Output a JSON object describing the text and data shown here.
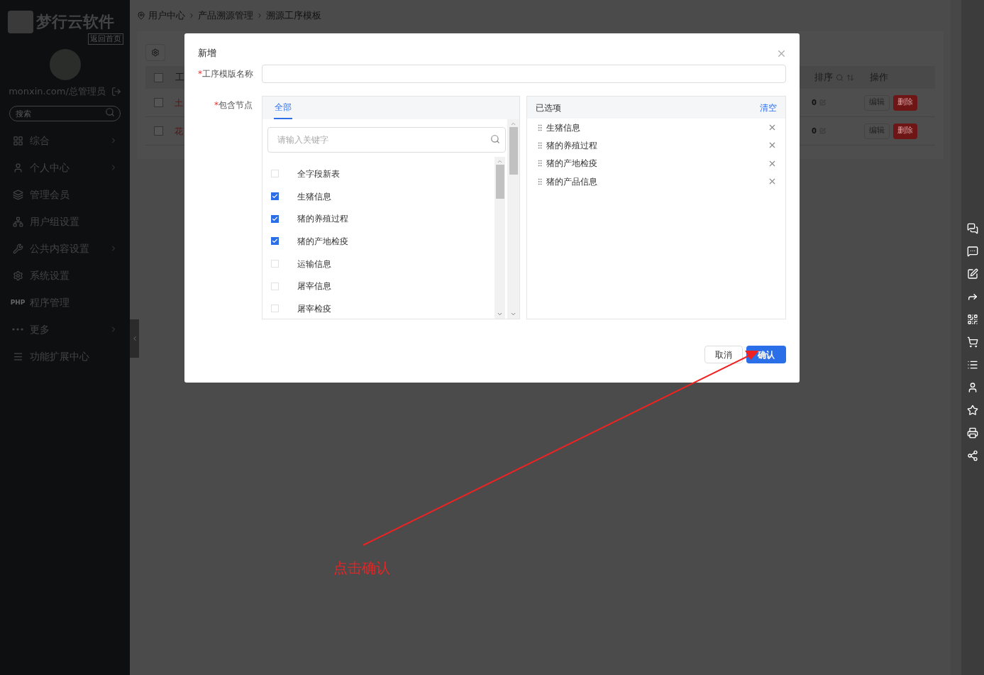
{
  "sidebar": {
    "logo_text": "梦行云软件",
    "home_link": "返回首页",
    "user": "monxin.com/总管理员",
    "search": {
      "placeholder": "搜索"
    },
    "items": [
      {
        "kind": "grid",
        "label": "综合",
        "expandable": true
      },
      {
        "kind": "user",
        "label": "个人中心",
        "expandable": true
      },
      {
        "kind": "layers",
        "label": "管理会员",
        "expandable": false
      },
      {
        "kind": "group",
        "label": "用户组设置",
        "expandable": false
      },
      {
        "kind": "tools",
        "label": "公共内容设置",
        "expandable": true
      },
      {
        "kind": "gear",
        "label": "系统设置",
        "expandable": false
      },
      {
        "kind": "text",
        "icon_text": "PHP",
        "label": "程序管理",
        "expandable": false
      },
      {
        "kind": "dots",
        "label": "更多",
        "expandable": true
      },
      {
        "kind": "menu",
        "label": "功能扩展中心",
        "expandable": false
      }
    ]
  },
  "breadcrumb": [
    "用户中心",
    "产品溯源管理",
    "溯源工序模板"
  ],
  "table": {
    "columns": [
      "工",
      "排序",
      "操作"
    ],
    "select_all_checked": false,
    "rows": [
      {
        "checked": false,
        "name": "土",
        "sort": "0",
        "actions": [
          "编辑",
          "删除"
        ]
      },
      {
        "checked": false,
        "name": "花",
        "sort": "0",
        "actions": [
          "编辑",
          "删除"
        ]
      }
    ]
  },
  "dialog": {
    "title": "新增",
    "name_field": {
      "required_mark": "*",
      "label": "工序模版名称"
    },
    "nodes_field": {
      "required_mark": "*",
      "label": "包含节点"
    },
    "source": {
      "tabs": [
        {
          "label": "全部",
          "selected": true
        }
      ],
      "search": {
        "placeholder": "请输入关键字"
      },
      "options": [
        {
          "label": "全字段新表",
          "checked": false
        },
        {
          "label": "生猪信息",
          "checked": true
        },
        {
          "label": "猪的养殖过程",
          "checked": true
        },
        {
          "label": "猪的产地检疫",
          "checked": true
        },
        {
          "label": "运输信息",
          "checked": false
        },
        {
          "label": "屠宰信息",
          "checked": false
        },
        {
          "label": "屠宰检疫",
          "checked": false
        }
      ]
    },
    "target": {
      "title": "已选项",
      "clear": "清空",
      "items": [
        "生猪信息",
        "猪的养殖过程",
        "猪的产地检疫",
        "猪的产品信息"
      ]
    },
    "buttons": {
      "cancel": "取消",
      "confirm": "确认"
    }
  },
  "annotation": {
    "text": "点击确认"
  }
}
